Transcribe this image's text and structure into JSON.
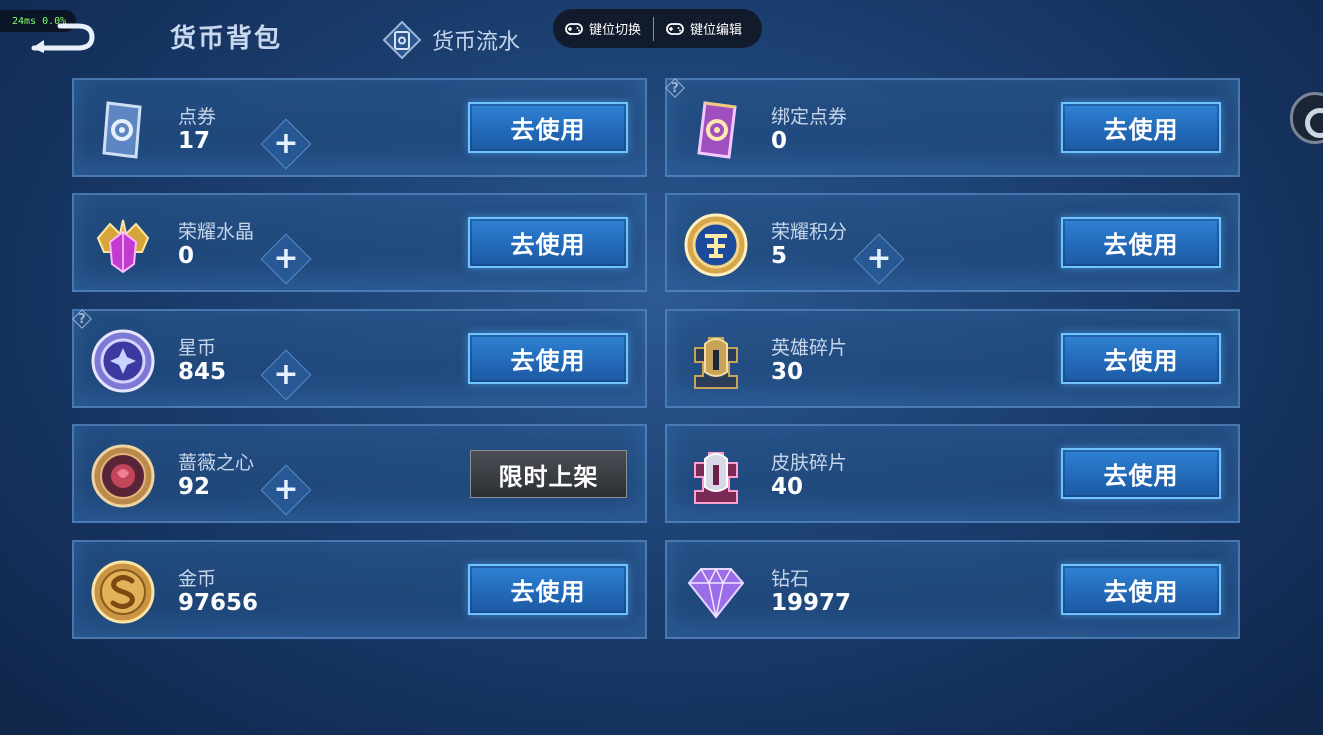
{
  "perf": {
    "latency": "24ms",
    "loss": "0.0%"
  },
  "header": {
    "title": "货币背包",
    "flow_tab": "货币流水"
  },
  "keybar": {
    "switch_label": "键位切换",
    "edit_label": "键位编辑"
  },
  "currencies": [
    {
      "name": "点券",
      "value": "17",
      "plus": true,
      "button": "去使用",
      "help": false,
      "icon": "ticket-blue-icon"
    },
    {
      "name": "绑定点券",
      "value": "0",
      "plus": false,
      "button": "去使用",
      "help": true,
      "icon": "ticket-purple-icon"
    },
    {
      "name": "荣耀水晶",
      "value": "0",
      "plus": true,
      "button": "去使用",
      "help": false,
      "icon": "crystal-icon"
    },
    {
      "name": "荣耀积分",
      "value": "5",
      "plus": true,
      "button": "去使用",
      "help": false,
      "icon": "points-medal-icon"
    },
    {
      "name": "星币",
      "value": "845",
      "plus": true,
      "button": "去使用",
      "help": true,
      "icon": "star-coin-icon"
    },
    {
      "name": "英雄碎片",
      "value": "30",
      "plus": false,
      "button": "去使用",
      "help": false,
      "icon": "hero-fragment-icon"
    },
    {
      "name": "蔷薇之心",
      "value": "92",
      "plus": true,
      "button": "限时上架",
      "help": false,
      "icon": "rose-heart-icon",
      "button_disabled": true
    },
    {
      "name": "皮肤碎片",
      "value": "40",
      "plus": false,
      "button": "去使用",
      "help": false,
      "icon": "skin-fragment-icon"
    },
    {
      "name": "金币",
      "value": "97656",
      "plus": false,
      "button": "去使用",
      "help": false,
      "icon": "gold-coin-icon"
    },
    {
      "name": "钻石",
      "value": "19977",
      "plus": false,
      "button": "去使用",
      "help": false,
      "icon": "diamond-icon"
    }
  ],
  "help_mark": "?"
}
